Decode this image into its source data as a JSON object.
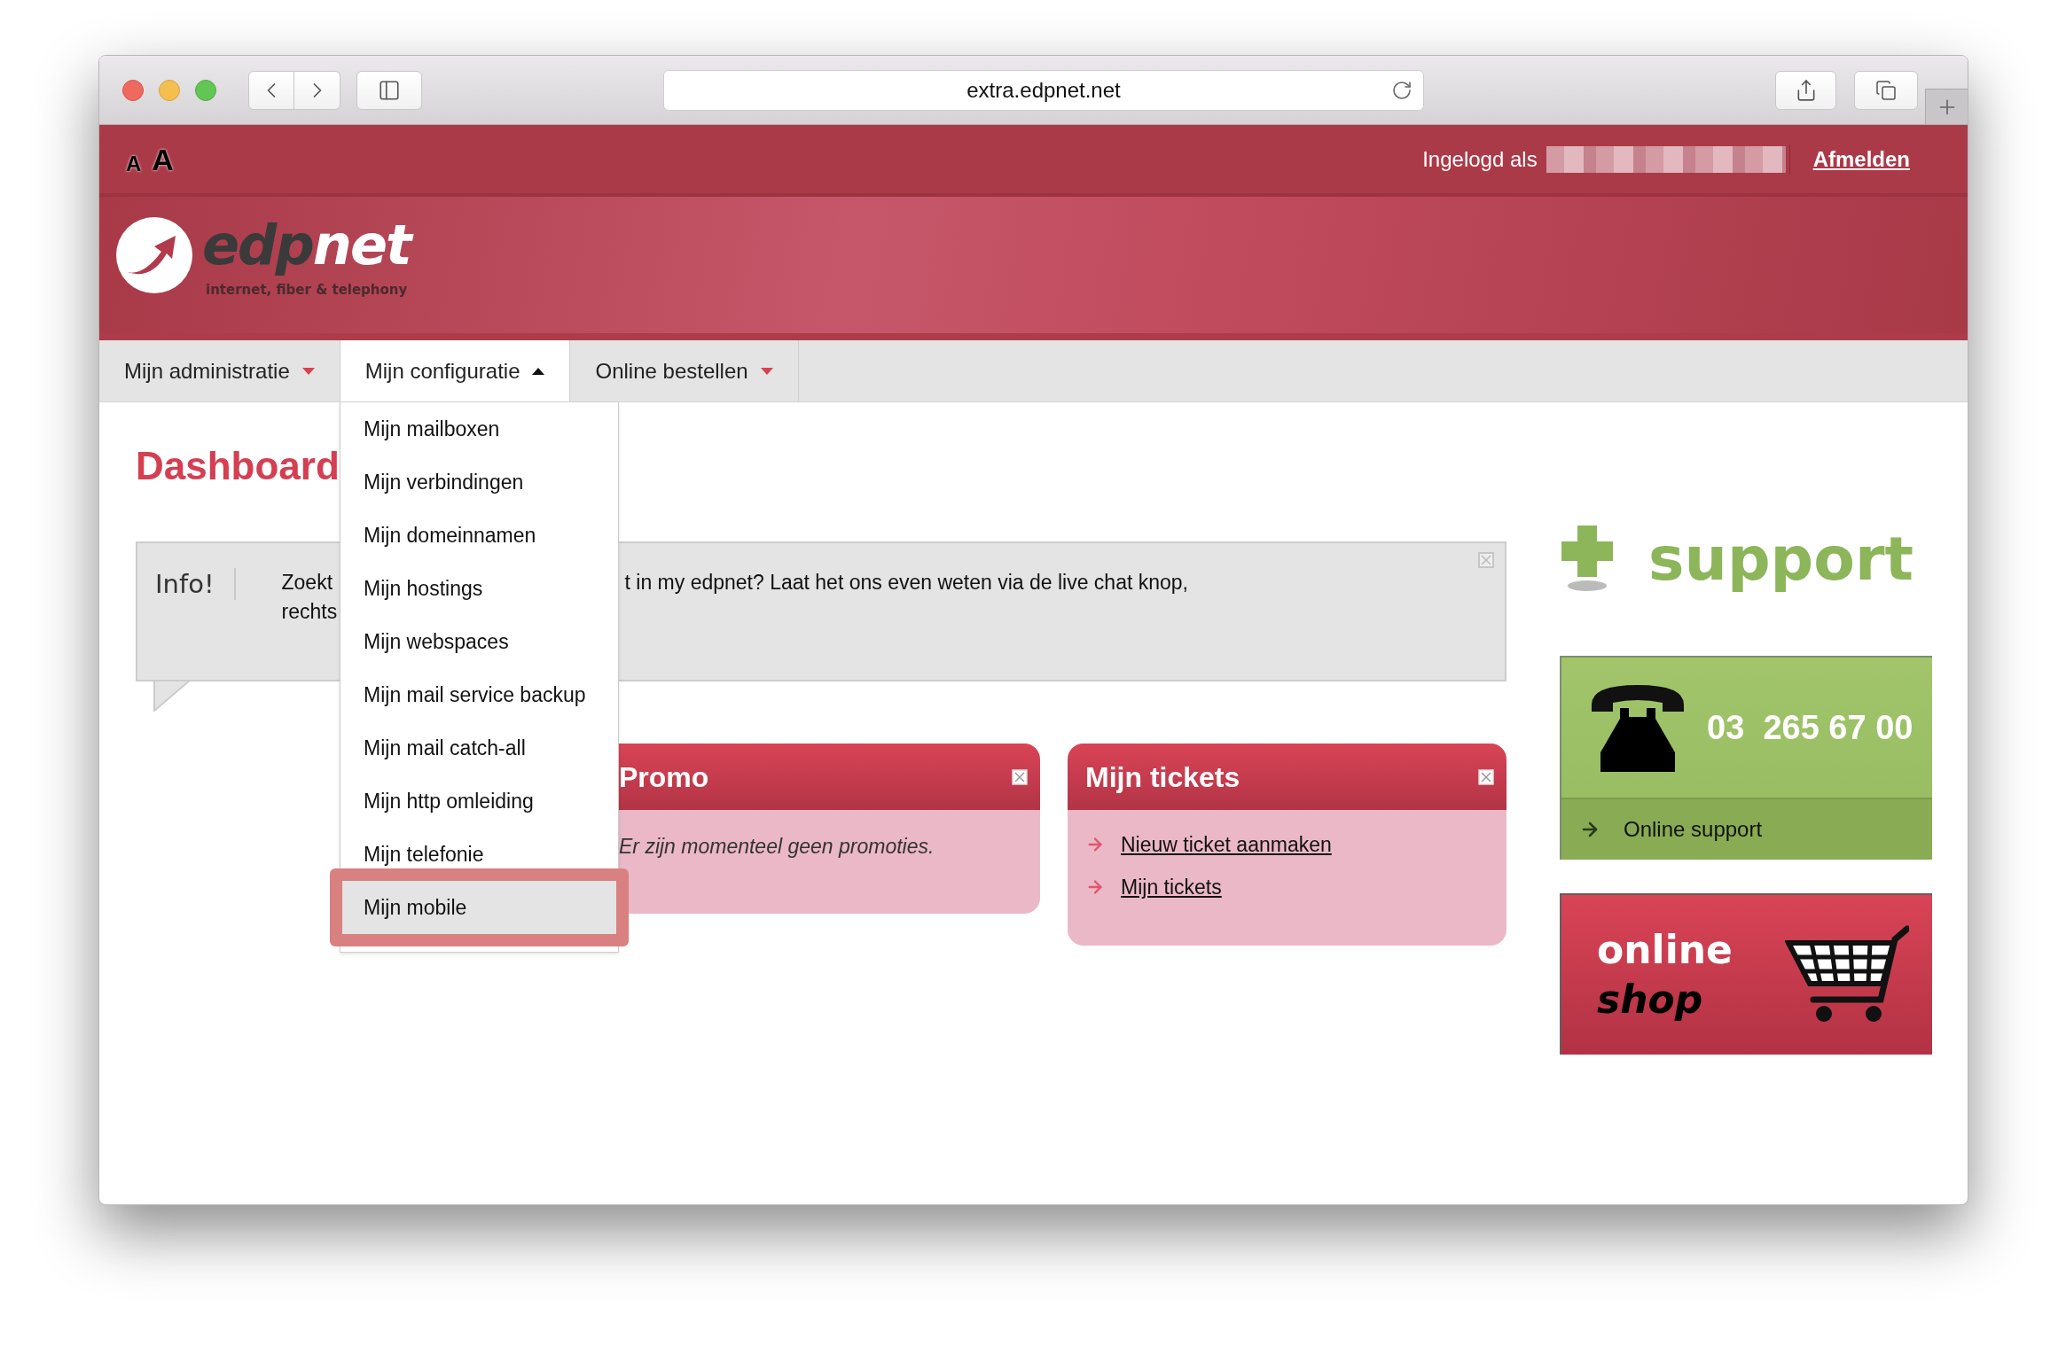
{
  "browser": {
    "url": "extra.edpnet.net"
  },
  "top_bar": {
    "font_size_buttons": [
      "A",
      "A"
    ],
    "logged_in_label": "Ingelogd als",
    "logout_link": "Afmelden"
  },
  "logo": {
    "name_dark": "edp",
    "name_light": "net",
    "tagline": "internet, fiber & telephony"
  },
  "nav": {
    "items": [
      {
        "label": "Mijn administratie",
        "expanded": false
      },
      {
        "label": "Mijn configuratie",
        "expanded": true
      },
      {
        "label": "Online bestellen",
        "expanded": false
      }
    ]
  },
  "dropdown": {
    "items": [
      {
        "label": "Mijn mailboxen",
        "selected": false
      },
      {
        "label": "Mijn verbindingen",
        "selected": false
      },
      {
        "label": "Mijn domeinnamen",
        "selected": false
      },
      {
        "label": "Mijn hostings",
        "selected": false
      },
      {
        "label": "Mijn webspaces",
        "selected": false
      },
      {
        "label": "Mijn mail service backup",
        "selected": false
      },
      {
        "label": "Mijn mail catch-all",
        "selected": false
      },
      {
        "label": "Mijn http omleiding",
        "selected": false
      },
      {
        "label": "Mijn telefonie",
        "selected": false
      },
      {
        "label": "Mijn mobile",
        "selected": true
      }
    ]
  },
  "page_title": "Dashboard",
  "info": {
    "label": "Info!",
    "text_left": [
      "Zoekt",
      "rechts"
    ],
    "text_right": "t in my edpnet? Laat het ons even weten via de live chat knop,"
  },
  "promo": {
    "title": "Promo",
    "message": "Er zijn momenteel geen promoties."
  },
  "tickets": {
    "title": "Mijn tickets",
    "links": [
      "Nieuw ticket aanmaken",
      "Mijn tickets"
    ]
  },
  "support": {
    "title": "support",
    "phone": "03  265 67 00",
    "online_support": "Online support"
  },
  "shop": {
    "line1": "online",
    "line2": "shop"
  }
}
